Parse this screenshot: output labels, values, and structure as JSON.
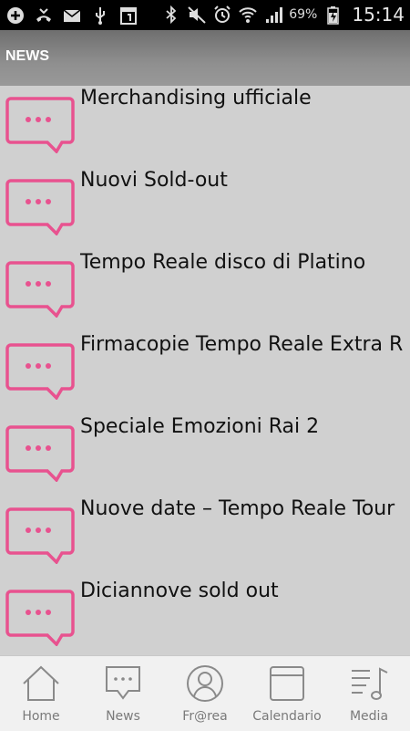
{
  "status_bar": {
    "battery": "69%",
    "time": "15:14"
  },
  "header": {
    "title": "NEWS"
  },
  "news_items": [
    {
      "title": "Merchandising ufficiale"
    },
    {
      "title": "Nuovi Sold-out"
    },
    {
      "title": "Tempo Reale disco di Platino"
    },
    {
      "title": "Firmacopie Tempo Reale Extra R"
    },
    {
      "title": "Speciale Emozioni Rai 2"
    },
    {
      "title": "Nuove date – Tempo Reale Tour"
    },
    {
      "title": "Diciannove sold out"
    }
  ],
  "tabs": [
    {
      "label": "Home",
      "icon": "home-icon"
    },
    {
      "label": "News",
      "icon": "chat-bubble-icon"
    },
    {
      "label": "Fr@rea",
      "icon": "user-circle-icon"
    },
    {
      "label": "Calendario",
      "icon": "calendar-icon"
    },
    {
      "label": "Media",
      "icon": "music-list-icon"
    }
  ],
  "colors": {
    "accent": "#e8528f",
    "header_bg": "#888888",
    "list_bg": "#d0d0d0",
    "tab_icon": "#8a8a8a"
  }
}
